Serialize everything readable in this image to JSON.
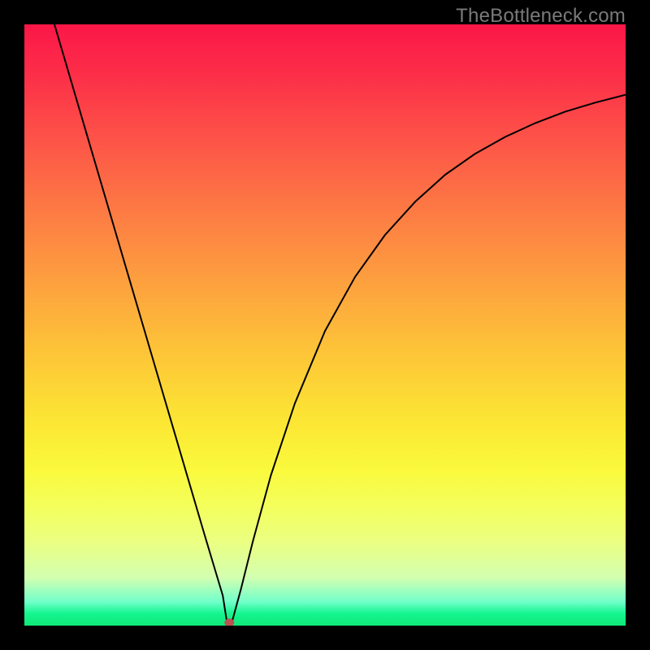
{
  "watermark": "TheBottleneck.com",
  "gradient_css": "linear-gradient(to bottom, #fb1747 0%, #fc2d48 8%, #fd4c48 17%, #fd6a46 26%, #fd8a42 36%, #fdaa3d 46%, #fdc937 56%, #fce634 66%, #faf93c 74%, #f4ff5b 80%, #ebff81 86%, #d3ffb0 92%, #72ffca 96%, #14f58f 98%, #10e878 100%)",
  "axis_color": "#000000",
  "curve_color": "#000000",
  "marker_color": "#bb5252",
  "chart_data": {
    "type": "line",
    "title": "",
    "xlabel": "",
    "ylabel": "",
    "xlim": [
      0,
      100
    ],
    "ylim": [
      0,
      100
    ],
    "annotations": [
      "TheBottleneck.com"
    ],
    "series": [
      {
        "name": "curve",
        "x": [
          5,
          10,
          15,
          20,
          25,
          30,
          31.5,
          33,
          33.7,
          34.5,
          36,
          38,
          41,
          45,
          50,
          55,
          60,
          65,
          70,
          75,
          80,
          85,
          90,
          95,
          100
        ],
        "y": [
          100,
          83,
          66,
          49,
          32,
          15,
          10,
          5,
          0.5,
          0.5,
          6,
          14,
          25,
          37,
          49,
          58,
          65,
          70.5,
          75,
          78.5,
          81.3,
          83.6,
          85.5,
          87.0,
          88.3
        ]
      }
    ],
    "marker": {
      "x": 34.1,
      "y": 0.5
    },
    "grid": false,
    "legend": false
  }
}
